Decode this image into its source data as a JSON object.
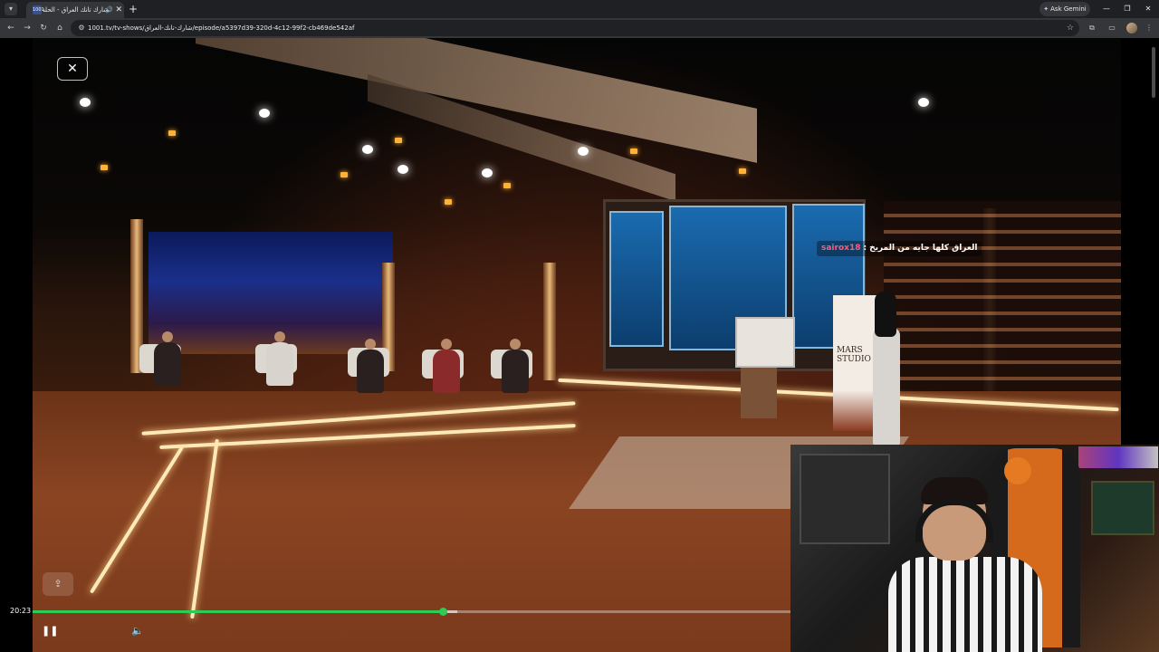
{
  "browser": {
    "tab": {
      "favicon_text": "1001",
      "title": "شارك تانك العراق - الحلقة 11"
    },
    "new_tab_icon": "plus-icon",
    "ask_gemini_label": "Ask Gemini",
    "address_bar": {
      "url": "1001.tv/tv-shows/شارك-تانك-العراق/episode/a5397d39-320d-4c12-99f2-cb469de542af"
    }
  },
  "player": {
    "chat": {
      "user": "sairox18",
      "separator": ":",
      "message": "العراق كلها جايه من المريخ"
    },
    "banner_text": "MARS STUDIO",
    "current_time": "20:23",
    "progress": 0.541,
    "buffered": 0.56,
    "controls": {
      "close_icon": "close-icon",
      "share_icon": "share-icon",
      "play_pause_icon": "pause-icon",
      "volume_icon": "volume-icon"
    },
    "colors": {
      "progress": "#2ecc52",
      "chat_user": "#ff5c7a"
    }
  }
}
